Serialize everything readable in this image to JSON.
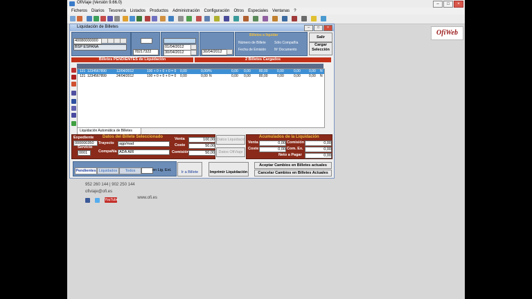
{
  "app": {
    "title": "OfiViaje (Versión 9.66.0)",
    "menu": [
      "Ficheros",
      "Diarios",
      "Tesorería",
      "Listados",
      "Productos",
      "Administración",
      "Configuración",
      "Otros",
      "Especiales",
      "Ventanas",
      "?"
    ]
  },
  "logo": "OfiWeb",
  "window": {
    "title": "Liquidación de Billetes",
    "bsp_code": "40080000000",
    "bsp_name": "BSP ESPAÑA",
    "num_liq": "78217322",
    "date_from": "01/04/2012",
    "date_to": "30/04/2012",
    "date_pay": "30/04/2012",
    "filter_title": "Billetes a liquidar",
    "filter_options": [
      "Número de Billete",
      "Sólo Compañía",
      "Fecha de Emisión",
      "Nº Documento"
    ],
    "salir": "Salir",
    "cargar": "Cargar Selección",
    "pending_header": "Billetes PENDIENTES de Liquidación",
    "loaded_header": "2 Billetes Cargados",
    "rows": [
      {
        "cia": "121",
        "num": "1234567890",
        "date": "12/04/2012",
        "importe": "100 + 0 + 0 + 0 = 0",
        "v1": "0,00",
        "v2": "0,00/%",
        "v3": "0,00",
        "v4": "0,00",
        "v5": "80,00",
        "v6": "0,00",
        "v7": "0,00",
        "v8": "0,00",
        "f": "N"
      },
      {
        "cia": "121",
        "num": "1234567899",
        "date": "24/04/2012",
        "importe": "100 + 0 + 0 + 0 = 0",
        "v1": "0,00",
        "v2": "0,00",
        "f0": "N",
        "v3": "0,00",
        "v4": "0,00",
        "v5": "80,00",
        "v6": "0,00",
        "v7": "0,00",
        "v8": "0,00",
        "f": "N"
      }
    ],
    "auto_tab": "Liquidación Automática de Billetes",
    "datos_header": "Datos del Billete Seleccionado",
    "expediente_label": "Expediente",
    "expediente": "000000350",
    "servicio_label": "Servicio",
    "servicio": "0001",
    "trayecto_label": "Trayecto",
    "trayecto": "agp/mad",
    "compania_label": "Compañía",
    "compania": "ADA AIR",
    "venta_label": "Venta",
    "venta": "100,00",
    "coste_label": "Coste",
    "coste": "50,00",
    "comision_label": "Comisión",
    "comision": "50,00",
    "datos_liq_btn": "Datos Liquidación",
    "datos_ofi_btn": "Datos OfiViaje",
    "acum_header": "Acumulados de la Liquidación",
    "acum_venta": "0,00",
    "acum_coste": "0,00",
    "acum_comision": "0,00",
    "acum_comex": "0,00",
    "acum_neto_label": "Neto a Pagar",
    "acum_neto": "0,00",
    "com_ex_label": "Com. Ex.",
    "tabs": [
      "Pendientes",
      "Liquidados",
      "Todos"
    ],
    "lig_ext": "en Lig. Ext.",
    "ir_billete": "Ir a Billete",
    "imprimir": "Imprimir Liquidación",
    "aceptar": "Aceptar Cambios en Billetes actuales",
    "cancelar": "Cancelar Cambios en Billetes Actuales"
  },
  "footer": {
    "phone": "952 260 144  |  902 250 144",
    "email": "ofiviaje@ofi.es",
    "web": "www.ofi.es",
    "youtube": "YouTube"
  },
  "colors": {
    "accent_red": "#c33018",
    "panel_blue": "#6c8db8",
    "selection": "#3d8fd4"
  }
}
